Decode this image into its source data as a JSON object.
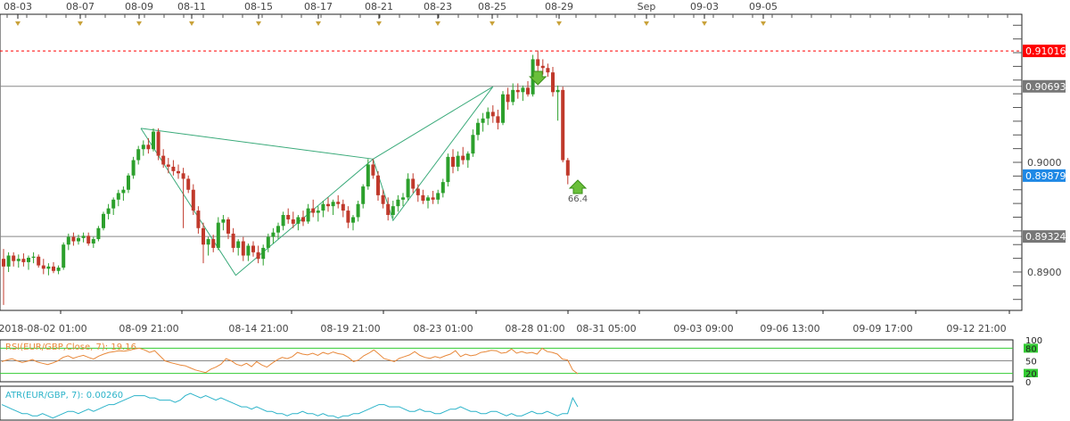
{
  "chart_data": {
    "type": "candlestick",
    "symbol": "EUR/GBP",
    "top_dates": [
      "08-03",
      "08-07",
      "08-09",
      "08-11",
      "08-15",
      "08-17",
      "08-21",
      "08-23",
      "08-25",
      "08-29",
      "Sep",
      "09-03",
      "09-05"
    ],
    "bottom_dates": [
      "2018-08-02 01:00",
      "08-09 21:00",
      "08-14 21:00",
      "08-19 21:00",
      "08-23 01:00",
      "08-28 01:00",
      "08-31 05:00",
      "09-03 09:00",
      "09-06 13:00",
      "09-09 17:00",
      "09-12 21:00"
    ],
    "price_axis": {
      "min": 0.8865,
      "max": 0.9135,
      "ticks": [
        0.89,
        0.8932,
        0.9,
        0.9069,
        0.9102
      ],
      "tick_labels": [
        "0.8900",
        "0.9000"
      ]
    },
    "price_labels": [
      {
        "value": 0.91016,
        "text": "0.91016",
        "color": "#ff0000"
      },
      {
        "value": 0.90693,
        "text": "0.90693",
        "color": "#777777"
      },
      {
        "value": 0.89879,
        "text": "0.89879",
        "color": "#1e88e5"
      },
      {
        "value": 0.89324,
        "text": "0.89324",
        "color": "#777777"
      }
    ],
    "horizontal_lines": [
      {
        "value": 0.91016,
        "style": "dotted",
        "color": "#ff0000"
      },
      {
        "value": 0.90693,
        "style": "solid",
        "color": "#888888"
      },
      {
        "value": 0.89324,
        "style": "solid",
        "color": "#888888"
      }
    ],
    "harmonic_pattern": [
      {
        "idx": 0,
        "price": 0.9031
      },
      {
        "idx": 1,
        "price": 0.8897
      },
      {
        "idx": 2,
        "price": 0.9003
      },
      {
        "idx": 3,
        "price": 0.8947
      },
      {
        "idx": 4,
        "price": 0.9069
      }
    ],
    "harmonic_color": "#3aaa7a",
    "annotation": {
      "text": "66.4",
      "price": 0.8978
    },
    "candles": [
      [
        0.8912,
        0.8921,
        0.887,
        0.8905
      ],
      [
        0.8905,
        0.8918,
        0.89,
        0.8915
      ],
      [
        0.8915,
        0.8918,
        0.8905,
        0.891
      ],
      [
        0.891,
        0.8916,
        0.8904,
        0.8912
      ],
      [
        0.8912,
        0.8917,
        0.8905,
        0.8909
      ],
      [
        0.8909,
        0.8915,
        0.8902,
        0.8913
      ],
      [
        0.8913,
        0.8918,
        0.8908,
        0.8914
      ],
      [
        0.8914,
        0.8916,
        0.8904,
        0.8906
      ],
      [
        0.8906,
        0.8912,
        0.8898,
        0.8903
      ],
      [
        0.8903,
        0.8908,
        0.8897,
        0.8905
      ],
      [
        0.8905,
        0.8909,
        0.8899,
        0.8901
      ],
      [
        0.8901,
        0.8906,
        0.8898,
        0.8904
      ],
      [
        0.8904,
        0.8927,
        0.8902,
        0.8925
      ],
      [
        0.8925,
        0.8935,
        0.892,
        0.8932
      ],
      [
        0.8932,
        0.8936,
        0.8924,
        0.8928
      ],
      [
        0.8928,
        0.8934,
        0.8925,
        0.8931
      ],
      [
        0.8931,
        0.8936,
        0.8927,
        0.8933
      ],
      [
        0.8933,
        0.8936,
        0.8924,
        0.8926
      ],
      [
        0.8926,
        0.8932,
        0.8922,
        0.893
      ],
      [
        0.893,
        0.8942,
        0.8928,
        0.894
      ],
      [
        0.894,
        0.8955,
        0.8938,
        0.8953
      ],
      [
        0.8953,
        0.8962,
        0.8948,
        0.8958
      ],
      [
        0.8958,
        0.8968,
        0.8952,
        0.8966
      ],
      [
        0.8966,
        0.8975,
        0.896,
        0.8972
      ],
      [
        0.8972,
        0.8978,
        0.8965,
        0.8975
      ],
      [
        0.8975,
        0.899,
        0.8972,
        0.8988
      ],
      [
        0.8988,
        0.9005,
        0.8985,
        0.9002
      ],
      [
        0.9002,
        0.9015,
        0.8998,
        0.9012
      ],
      [
        0.9012,
        0.902,
        0.9006,
        0.9016
      ],
      [
        0.9016,
        0.9022,
        0.9008,
        0.9012
      ],
      [
        0.9012,
        0.9031,
        0.901,
        0.9028
      ],
      [
        0.9028,
        0.9031,
        0.9002,
        0.9006
      ],
      [
        0.9006,
        0.9012,
        0.8995,
        0.8998
      ],
      [
        0.8998,
        0.9004,
        0.899,
        0.8996
      ],
      [
        0.8996,
        0.9002,
        0.8988,
        0.8992
      ],
      [
        0.8992,
        0.8998,
        0.8985,
        0.899
      ],
      [
        0.899,
        0.8995,
        0.894,
        0.8985
      ],
      [
        0.8985,
        0.8988,
        0.8972,
        0.8975
      ],
      [
        0.8975,
        0.898,
        0.8952,
        0.8956
      ],
      [
        0.8956,
        0.896,
        0.8935,
        0.894
      ],
      [
        0.894,
        0.8945,
        0.8908,
        0.8925
      ],
      [
        0.8925,
        0.8932,
        0.8915,
        0.893
      ],
      [
        0.893,
        0.8934,
        0.8918,
        0.8922
      ],
      [
        0.8922,
        0.895,
        0.892,
        0.8945
      ],
      [
        0.8945,
        0.8952,
        0.8938,
        0.8948
      ],
      [
        0.8948,
        0.895,
        0.893,
        0.8935
      ],
      [
        0.8935,
        0.894,
        0.8918,
        0.8922
      ],
      [
        0.8922,
        0.893,
        0.8915,
        0.8928
      ],
      [
        0.8928,
        0.8932,
        0.891,
        0.8915
      ],
      [
        0.8915,
        0.8926,
        0.891,
        0.8924
      ],
      [
        0.8924,
        0.8928,
        0.8914,
        0.8918
      ],
      [
        0.8918,
        0.8924,
        0.8908,
        0.8912
      ],
      [
        0.8912,
        0.8925,
        0.8906,
        0.8922
      ],
      [
        0.8922,
        0.8935,
        0.8918,
        0.8932
      ],
      [
        0.8932,
        0.894,
        0.8926,
        0.8936
      ],
      [
        0.8936,
        0.8945,
        0.893,
        0.8942
      ],
      [
        0.8942,
        0.8955,
        0.8938,
        0.8952
      ],
      [
        0.8952,
        0.8958,
        0.8944,
        0.8948
      ],
      [
        0.8948,
        0.8955,
        0.894,
        0.8944
      ],
      [
        0.8944,
        0.8952,
        0.8938,
        0.895
      ],
      [
        0.895,
        0.8956,
        0.8942,
        0.8946
      ],
      [
        0.8946,
        0.8962,
        0.8944,
        0.8958
      ],
      [
        0.8958,
        0.8966,
        0.895,
        0.8954
      ],
      [
        0.8954,
        0.896,
        0.8946,
        0.8956
      ],
      [
        0.8956,
        0.8965,
        0.895,
        0.8962
      ],
      [
        0.8962,
        0.8968,
        0.8955,
        0.896
      ],
      [
        0.896,
        0.8966,
        0.8952,
        0.8964
      ],
      [
        0.8964,
        0.897,
        0.8958,
        0.8962
      ],
      [
        0.8962,
        0.8966,
        0.895,
        0.8956
      ],
      [
        0.8956,
        0.896,
        0.894,
        0.8945
      ],
      [
        0.8945,
        0.8952,
        0.8938,
        0.895
      ],
      [
        0.895,
        0.8965,
        0.8946,
        0.8962
      ],
      [
        0.8962,
        0.898,
        0.8958,
        0.8978
      ],
      [
        0.8978,
        0.9003,
        0.8975,
        0.8998
      ],
      [
        0.8998,
        0.9003,
        0.8985,
        0.8988
      ],
      [
        0.8988,
        0.8992,
        0.8965,
        0.897
      ],
      [
        0.897,
        0.8975,
        0.8958,
        0.8962
      ],
      [
        0.8962,
        0.8968,
        0.8947,
        0.8952
      ],
      [
        0.8952,
        0.8965,
        0.8949,
        0.896
      ],
      [
        0.896,
        0.897,
        0.8955,
        0.8966
      ],
      [
        0.8966,
        0.8972,
        0.896,
        0.8968
      ],
      [
        0.8968,
        0.899,
        0.8965,
        0.8985
      ],
      [
        0.8985,
        0.899,
        0.8972,
        0.8976
      ],
      [
        0.8976,
        0.898,
        0.8964,
        0.897
      ],
      [
        0.897,
        0.8975,
        0.8962,
        0.8965
      ],
      [
        0.8965,
        0.897,
        0.8958,
        0.8968
      ],
      [
        0.8968,
        0.8974,
        0.8962,
        0.8966
      ],
      [
        0.8966,
        0.8975,
        0.8962,
        0.8972
      ],
      [
        0.8972,
        0.8985,
        0.8968,
        0.8982
      ],
      [
        0.8982,
        0.9008,
        0.8978,
        0.9005
      ],
      [
        0.9005,
        0.9012,
        0.899,
        0.8996
      ],
      [
        0.8996,
        0.901,
        0.8992,
        0.9006
      ],
      [
        0.9006,
        0.9014,
        0.8998,
        0.9002
      ],
      [
        0.9002,
        0.901,
        0.8995,
        0.9008
      ],
      [
        0.9008,
        0.903,
        0.9005,
        0.9025
      ],
      [
        0.9025,
        0.904,
        0.902,
        0.9036
      ],
      [
        0.9036,
        0.9045,
        0.9028,
        0.904
      ],
      [
        0.904,
        0.905,
        0.9034,
        0.9046
      ],
      [
        0.9046,
        0.9052,
        0.9036,
        0.9042
      ],
      [
        0.9042,
        0.9048,
        0.903,
        0.9036
      ],
      [
        0.9036,
        0.9065,
        0.9034,
        0.9062
      ],
      [
        0.9062,
        0.9068,
        0.9048,
        0.9055
      ],
      [
        0.9055,
        0.9072,
        0.9052,
        0.9066
      ],
      [
        0.9066,
        0.9072,
        0.9058,
        0.9064
      ],
      [
        0.9064,
        0.907,
        0.9056,
        0.9068
      ],
      [
        0.9068,
        0.9074,
        0.906,
        0.9062
      ],
      [
        0.9062,
        0.9098,
        0.906,
        0.9094
      ],
      [
        0.9094,
        0.9102,
        0.9082,
        0.9088
      ],
      [
        0.9088,
        0.9094,
        0.908,
        0.9086
      ],
      [
        0.9086,
        0.909,
        0.9078,
        0.9082
      ],
      [
        0.9082,
        0.9087,
        0.906,
        0.9064
      ],
      [
        0.9064,
        0.907,
        0.9038,
        0.9066
      ],
      [
        0.9066,
        0.9069,
        0.9,
        0.9002
      ],
      [
        0.9002,
        0.9004,
        0.898,
        0.8988
      ]
    ],
    "rsi": {
      "label": "RSI(EUR/GBP,Close, 7): 19.16",
      "levels": [
        "100",
        "80",
        "50",
        "20",
        "0"
      ],
      "min": 0,
      "max": 100,
      "values": [
        48,
        52,
        55,
        50,
        46,
        49,
        53,
        47,
        44,
        41,
        45,
        50,
        58,
        62,
        56,
        60,
        63,
        58,
        54,
        61,
        66,
        70,
        72,
        74,
        73,
        75,
        78,
        80,
        76,
        70,
        74,
        62,
        50,
        46,
        43,
        40,
        38,
        33,
        28,
        25,
        22,
        30,
        35,
        42,
        55,
        50,
        42,
        38,
        44,
        36,
        48,
        40,
        35,
        44,
        52,
        58,
        55,
        60,
        70,
        66,
        64,
        68,
        63,
        70,
        66,
        71,
        67,
        65,
        58,
        48,
        52,
        62,
        68,
        76,
        66,
        55,
        52,
        48,
        56,
        60,
        64,
        72,
        63,
        58,
        56,
        60,
        57,
        62,
        66,
        74,
        60,
        66,
        62,
        64,
        70,
        72,
        75,
        74,
        68,
        70,
        78,
        68,
        72,
        68,
        70,
        66,
        80,
        72,
        70,
        66,
        54,
        52,
        28,
        19.16
      ]
    },
    "atr": {
      "label": "ATR(EUR/GBP, 7): 0.00260",
      "min": 0.00205,
      "max": 0.0034,
      "values": [
        0.0027,
        0.0026,
        0.0025,
        0.0024,
        0.0023,
        0.0023,
        0.0022,
        0.0022,
        0.0023,
        0.0022,
        0.0021,
        0.0022,
        0.0023,
        0.0024,
        0.0024,
        0.0023,
        0.0024,
        0.0025,
        0.0024,
        0.0025,
        0.0026,
        0.0027,
        0.0027,
        0.0028,
        0.0029,
        0.003,
        0.0031,
        0.0031,
        0.0031,
        0.003,
        0.003,
        0.0029,
        0.0029,
        0.0029,
        0.0028,
        0.0029,
        0.0031,
        0.0032,
        0.0031,
        0.003,
        0.0031,
        0.003,
        0.0029,
        0.003,
        0.0029,
        0.0028,
        0.0027,
        0.0026,
        0.0026,
        0.0025,
        0.0026,
        0.0025,
        0.0024,
        0.0024,
        0.0023,
        0.0023,
        0.0022,
        0.0023,
        0.0023,
        0.0024,
        0.0023,
        0.0023,
        0.0022,
        0.0023,
        0.0022,
        0.0022,
        0.0021,
        0.0022,
        0.0022,
        0.0023,
        0.0023,
        0.0024,
        0.0025,
        0.0026,
        0.0027,
        0.0027,
        0.0026,
        0.0026,
        0.0026,
        0.0025,
        0.0024,
        0.0024,
        0.0025,
        0.0024,
        0.0024,
        0.0023,
        0.0023,
        0.0024,
        0.0025,
        0.0025,
        0.0026,
        0.0025,
        0.0024,
        0.0024,
        0.0023,
        0.0023,
        0.0024,
        0.0024,
        0.0023,
        0.0022,
        0.0023,
        0.0022,
        0.0022,
        0.0023,
        0.0024,
        0.0023,
        0.0023,
        0.0024,
        0.0023,
        0.0022,
        0.0023,
        0.0023,
        0.003,
        0.0026
      ]
    }
  }
}
